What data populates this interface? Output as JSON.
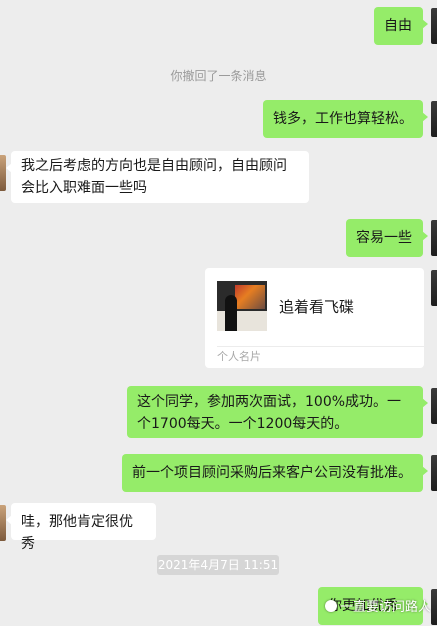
{
  "messages": [
    {
      "id": "m1",
      "text": "自由"
    },
    {
      "id": "sys",
      "text": "你撤回了一条消息"
    },
    {
      "id": "m2",
      "text": "钱多，工作也算轻松。"
    },
    {
      "id": "m3",
      "text": "我之后考虑的方向也是自由顾问，自由顾问会比入职难面一些吗"
    },
    {
      "id": "m4",
      "text": "容易一些"
    },
    {
      "id": "m6",
      "text": "这个同学，参加两次面试，100%成功。一个1700每天。一个1200每天的。"
    },
    {
      "id": "m7",
      "text": "前一个项目顾问采购后来客户公司没有批准。"
    },
    {
      "id": "m8",
      "text": "哇，那他肯定很优秀"
    },
    {
      "id": "m9",
      "text": "你更加优秀"
    }
  ],
  "contact_card": {
    "name": "追着看飞碟",
    "type_label": "个人名片"
  },
  "timestamp": "2021年4月7日 11:51",
  "watermark": "一直要访问路人",
  "colors": {
    "sent_bubble": "#95ec69",
    "received_bubble": "#ffffff",
    "background": "#ededed"
  }
}
